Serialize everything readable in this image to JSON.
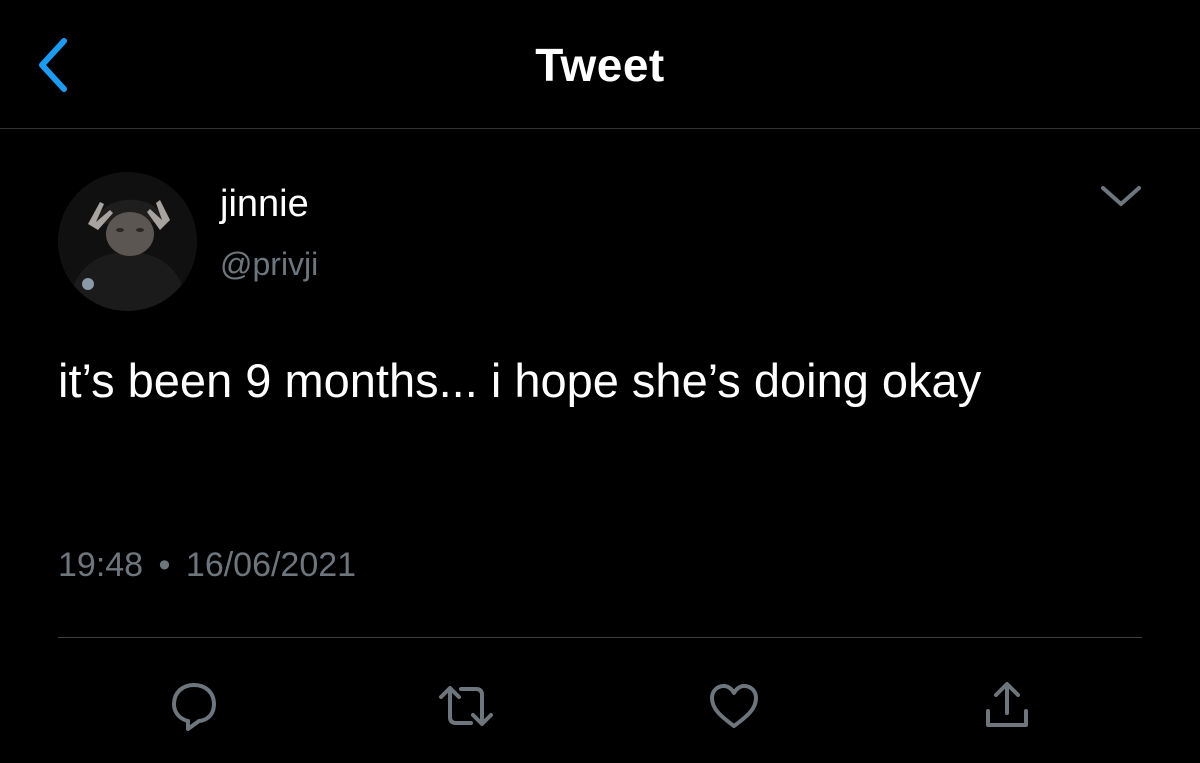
{
  "header": {
    "title": "Tweet",
    "back_icon": "chevron-left-icon"
  },
  "colors": {
    "background": "#000000",
    "accent": "#1d9bf0",
    "primary_text": "#ffffff",
    "secondary_text": "#6e767d",
    "divider": "#2f3336"
  },
  "tweet": {
    "author": {
      "display_name": "jinnie",
      "handle": "@privji"
    },
    "text": "it’s been 9 months... i hope she’s doing okay",
    "time": "19:48",
    "separator": "•",
    "date": "16/06/2021"
  },
  "actions": [
    {
      "name": "reply",
      "icon": "reply-icon"
    },
    {
      "name": "retweet",
      "icon": "retweet-icon"
    },
    {
      "name": "like",
      "icon": "heart-icon"
    },
    {
      "name": "share",
      "icon": "share-icon"
    }
  ]
}
